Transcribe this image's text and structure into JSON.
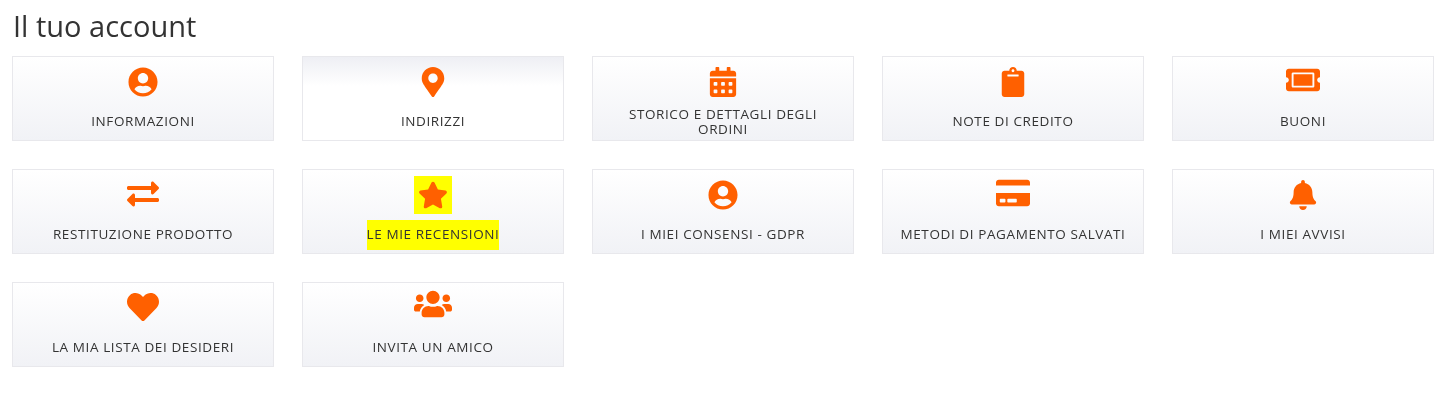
{
  "title": "Il tuo account",
  "tiles": [
    {
      "kind": "user",
      "label": "INFORMAZIONI",
      "hovered": false,
      "highlighted": false
    },
    {
      "kind": "pin",
      "label": "INDIRIZZI",
      "hovered": true,
      "highlighted": false
    },
    {
      "kind": "calendar",
      "label": "STORICO E DETTAGLI DEGLI ORDINI",
      "hovered": false,
      "highlighted": false
    },
    {
      "kind": "clipboard",
      "label": "NOTE DI CREDITO",
      "hovered": false,
      "highlighted": false
    },
    {
      "kind": "ticket",
      "label": "BUONI",
      "hovered": false,
      "highlighted": false
    },
    {
      "kind": "exchange",
      "label": "RESTITUZIONE PRODOTTO",
      "hovered": false,
      "highlighted": false
    },
    {
      "kind": "star",
      "label": "LE MIE RECENSIONI",
      "hovered": false,
      "highlighted": true
    },
    {
      "kind": "user",
      "label": "I MIEI CONSENSI - GDPR",
      "hovered": false,
      "highlighted": false
    },
    {
      "kind": "card",
      "label": "METODI DI PAGAMENTO SALVATI",
      "hovered": false,
      "highlighted": false
    },
    {
      "kind": "bell",
      "label": "I MIEI AVVISI",
      "hovered": false,
      "highlighted": false
    },
    {
      "kind": "heart",
      "label": "LA MIA LISTA DEI DESIDERI",
      "hovered": false,
      "highlighted": false
    },
    {
      "kind": "users",
      "label": "INVITA UN AMICO",
      "hovered": false,
      "highlighted": false
    }
  ]
}
